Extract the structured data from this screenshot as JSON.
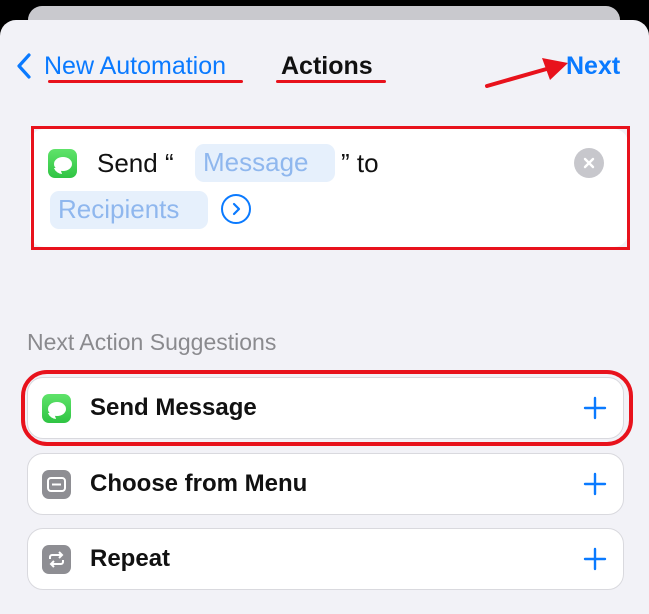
{
  "nav": {
    "back_label": "New Automation",
    "title": "Actions",
    "next_label": "Next"
  },
  "action": {
    "verb": "Send “",
    "message_token": "Message",
    "connector": "” to",
    "recipients_token": "Recipients",
    "icon": "messages-icon"
  },
  "suggestions": {
    "header": "Next Action Suggestions",
    "items": [
      {
        "label": "Send Message",
        "icon": "messages-icon"
      },
      {
        "label": "Choose from Menu",
        "icon": "menu-icon"
      },
      {
        "label": "Repeat",
        "icon": "repeat-icon"
      }
    ]
  },
  "colors": {
    "accent": "#0a7aff",
    "annotation": "#e8121c",
    "token_bg": "#e6f0fc",
    "token_text": "#8fb7ee",
    "messages_green": "#34c759"
  }
}
